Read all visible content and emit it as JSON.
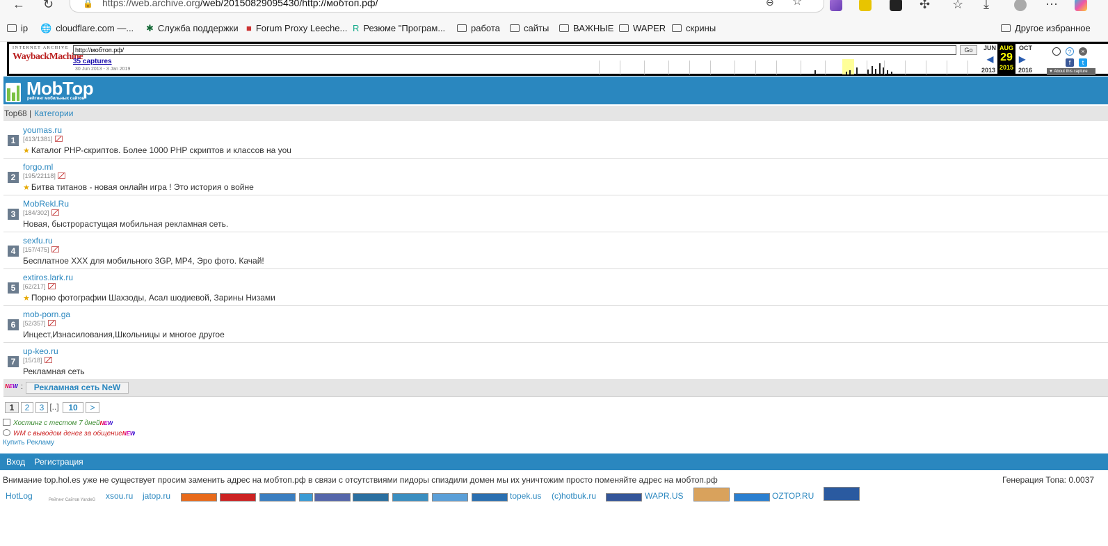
{
  "browser": {
    "url_host": "https://web.archive.org",
    "url_path": "/web/20150829095430/http://мобтоп.рф/",
    "bookmarks": [
      "ip",
      "cloudflare.com —...",
      "Служба поддержки",
      "Forum Proxy Leeche...",
      "Резюме \"Програм...",
      "работа",
      "сайты",
      "ВАЖНЫЕ",
      "WAPER",
      "скрины"
    ],
    "other_bookmarks": "Другое избранное"
  },
  "wayback": {
    "logo_top": "INTERNET ARCHIVE",
    "logo_main": "WaybackMachine",
    "url": "http://мобтоп.рф/",
    "go": "Go",
    "captures": "35 captures",
    "range": "30 Jun 2013 - 3 Jan 2019",
    "prev_month": "JUN",
    "cur_month": "AUG",
    "next_month": "OCT",
    "day": "29",
    "prev_year": "2013",
    "cur_year": "2015",
    "next_year": "2016",
    "about": "▼ About this capture"
  },
  "site": {
    "logo": "MobTop",
    "logo_sub": "рейтинг мобильных сайтов",
    "nav_top": "Top68 |",
    "nav_categories": "Категории"
  },
  "rows": [
    {
      "rank": "1",
      "site": "youmas.ru",
      "stats": "[413/1381]",
      "star": true,
      "desc": "Каталог PHP-скриптов. Более 1000 PHP скриптов и классов на you"
    },
    {
      "rank": "2",
      "site": "forgo.ml",
      "stats": "[195/22118]",
      "star": true,
      "desc": "Битва титанов - новая онлайн игра ! Это история о войне"
    },
    {
      "rank": "3",
      "site": "MobRekl.Ru",
      "stats": "[184/302]",
      "star": false,
      "desc": "Новая, быстрорастущая мобильная рекламная сеть."
    },
    {
      "rank": "4",
      "site": "sexfu.ru",
      "stats": "[157/475]",
      "star": false,
      "desc": "Бесплатное XXX для мобильного 3GP, MP4, Эро фото. Качай!"
    },
    {
      "rank": "5",
      "site": "extiros.lark.ru",
      "stats": "[62/217]",
      "star": true,
      "desc": "Порно фотографии Шахзоды, Асал шодиевой, Зарины Низами"
    },
    {
      "rank": "6",
      "site": "mob-porn.ga",
      "stats": "[52/357]",
      "star": false,
      "desc": "Инцест,Изнасилования,Школьницы и многое другое"
    },
    {
      "rank": "7",
      "site": "up-keo.ru",
      "stats": "[15/18]",
      "star": false,
      "desc": "Рекламная сеть"
    }
  ],
  "promo": {
    "new": "NEW",
    "colon": ":",
    "button": "Рекламная сеть NeW"
  },
  "pager": {
    "p1": "1",
    "p2": "2",
    "p3": "3",
    "dots": "[..]",
    "p10": "10",
    "next": ">"
  },
  "links": {
    "hosting": "Хостинг с тестом 7 дней",
    "wm": "WM с выводом денег за общение",
    "buy": "Купить Рекламу",
    "new": "NEW"
  },
  "footer": {
    "login": "Вход",
    "register": "Регистрация"
  },
  "notice": "Внимание top.hol.es уже не существует просим заменить адрес на мобтоп.рф в связи с отсутствиями пидоры спиздили домен мы их уничтожим просто поменяйте адрес на мобтоп.рф",
  "generation": "Генерация Топа: 0.0037",
  "counters": [
    "HotLog",
    "Рейтинг Сайтов YandeG",
    "xsou.ru",
    "jatop.ru",
    "topek.us",
    "(c)hotbuk.ru",
    "WAPR.US",
    "OZTOP.RU"
  ],
  "colors": {
    "brand": "#2a87bf",
    "nav_bg": "#e5e5e5",
    "rank_bg": "#6b7c8e"
  }
}
